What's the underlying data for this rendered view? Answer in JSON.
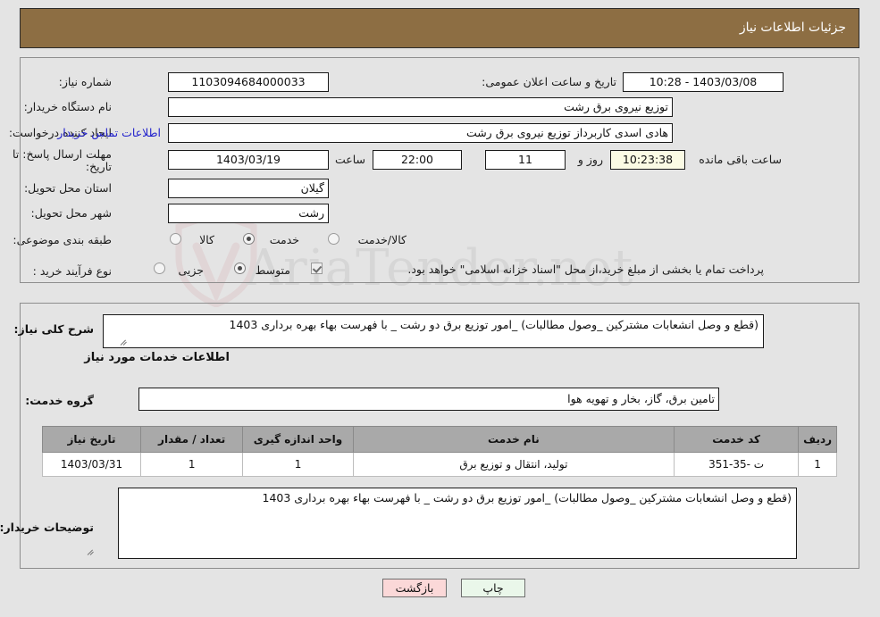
{
  "header": {
    "title": "جزئیات اطلاعات نیاز",
    "bar_color": "#8d6e43"
  },
  "watermark": {
    "text": "AriaTender.net"
  },
  "form": {
    "need_number": {
      "label": "شماره نیاز:",
      "value": "1103094684000033"
    },
    "public_announcement": {
      "label": "تاریخ و ساعت اعلان عمومی:",
      "value": "1403/03/08 - 10:28"
    },
    "buyer_org": {
      "label": "نام دستگاه خریدار:",
      "value": "توزیع نیروی برق رشت"
    },
    "request_creator": {
      "label": "ایجاد کننده درخواست:",
      "value": "هادی  اسدی کاربرداز توزیع نیروی برق رشت"
    },
    "buyer_contact_link": "اطلاعات تماس خریدار",
    "response_deadline": {
      "label": "مهلت ارسال پاسخ: تا تاریخ:",
      "date": "1403/03/19",
      "hour_label": "ساعت",
      "time": "22:00",
      "days": "11",
      "days_label": "روز و",
      "countdown": "10:23:38",
      "remaining_label": "ساعت باقی مانده"
    },
    "delivery_province": {
      "label": "استان محل تحویل:",
      "value": "گیلان"
    },
    "delivery_city": {
      "label": "شهر محل تحویل:",
      "value": "رشت"
    },
    "subject_category": {
      "label": "طبقه بندی موضوعی:",
      "options": [
        {
          "label": "کالا",
          "selected": false
        },
        {
          "label": "خدمت",
          "selected": true
        },
        {
          "label": "کالا/خدمت",
          "selected": false
        }
      ]
    },
    "purchase_process": {
      "label": "نوع فرآیند خرید :",
      "options": [
        {
          "label": "جزیی",
          "selected": false
        },
        {
          "label": "متوسط",
          "selected": true
        }
      ],
      "treasury_checkbox_checked": true,
      "treasury_note": "پرداخت تمام یا بخشی از مبلغ خرید،از محل \"اسناد خزانه اسلامی\" خواهد بود."
    }
  },
  "need_description": {
    "label": "شرح کلی نیاز:",
    "value": "(قطع و وصل انشعابات مشترکین _وصول مطالبات) _امور توزیع برق دو رشت _ با فهرست بهاء بهره برداری 1403"
  },
  "services_section": {
    "title": "اطلاعات خدمات مورد نیاز",
    "service_group": {
      "label": "گروه خدمت:",
      "value": "تامین برق، گاز، بخار و تهویه هوا"
    },
    "table": {
      "columns": [
        "ردیف",
        "کد خدمت",
        "نام خدمت",
        "واحد اندازه گیری",
        "تعداد / مقدار",
        "تاریخ نیاز"
      ],
      "rows": [
        {
          "row_no": "1",
          "service_code": "ت -35-351",
          "service_name": "تولید، انتقال و توزیع برق",
          "unit": "1",
          "quantity": "1",
          "need_date": "1403/03/31"
        }
      ]
    }
  },
  "buyer_notes": {
    "label": "توضیحات خریدار:",
    "value": "(قطع و وصل انشعابات مشترکین _وصول مطالبات) _امور توزیع برق دو رشت _ با فهرست بهاء بهره برداری 1403"
  },
  "buttons": {
    "print": "چاپ",
    "back": "بازگشت"
  }
}
